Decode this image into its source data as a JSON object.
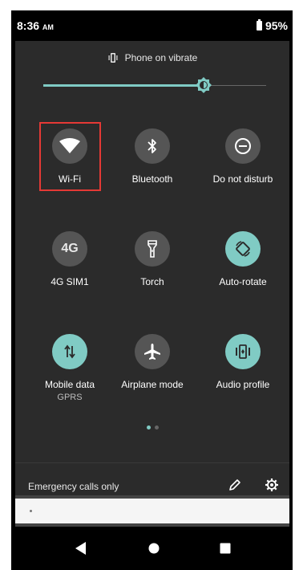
{
  "status_bar": {
    "time": "8:36",
    "ampm": "AM",
    "battery": "95%"
  },
  "vibrate": {
    "label": "Phone on vibrate"
  },
  "brightness": {
    "level_percent": 72
  },
  "tiles": [
    {
      "label": "Wi-Fi",
      "sublabel": "",
      "icon": "wifi-icon",
      "active": false
    },
    {
      "label": "Bluetooth",
      "sublabel": "",
      "icon": "bluetooth-icon",
      "active": false
    },
    {
      "label": "Do not disturb",
      "sublabel": "",
      "icon": "do-not-disturb-icon",
      "active": false
    },
    {
      "label": "4G SIM1",
      "sublabel": "",
      "icon": "4g-icon",
      "active": false,
      "icon_text": "4G"
    },
    {
      "label": "Torch",
      "sublabel": "",
      "icon": "torch-icon",
      "active": false
    },
    {
      "label": "Auto-rotate",
      "sublabel": "",
      "icon": "auto-rotate-icon",
      "active": true
    },
    {
      "label": "Mobile data",
      "sublabel": "GPRS",
      "icon": "mobile-data-icon",
      "active": true
    },
    {
      "label": "Airplane mode",
      "sublabel": "",
      "icon": "airplane-icon",
      "active": false
    },
    {
      "label": "Audio profile",
      "sublabel": "",
      "icon": "audio-profile-icon",
      "active": true
    }
  ],
  "footer": {
    "emergency": "Emergency calls only"
  },
  "colors": {
    "accent": "#80cbc4",
    "panel": "#2b2b2b",
    "inactive_circle": "#555555",
    "highlight": "#e53935"
  }
}
